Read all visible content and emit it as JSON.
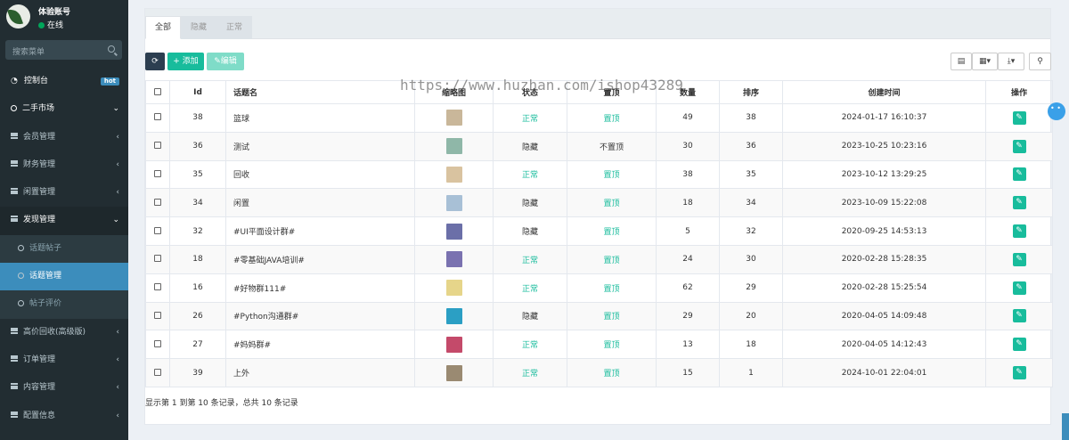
{
  "user": {
    "name": "体验账号",
    "status": "在线"
  },
  "search": {
    "placeholder": "搜索菜单"
  },
  "menu": [
    {
      "label": "控制台",
      "type": "top",
      "badge": "hot"
    },
    {
      "label": "二手市场",
      "type": "top",
      "caret": "⌄"
    },
    {
      "label": "会员管理",
      "type": "item",
      "caret": "‹"
    },
    {
      "label": "财务管理",
      "type": "item",
      "caret": "‹"
    },
    {
      "label": "闲置管理",
      "type": "item",
      "caret": "‹"
    },
    {
      "label": "发现管理",
      "type": "open",
      "caret": "⌄"
    },
    {
      "label": "话题帖子",
      "type": "sub"
    },
    {
      "label": "话题管理",
      "type": "active"
    },
    {
      "label": "帖子评价",
      "type": "sub"
    },
    {
      "label": "高价回收(高级版)",
      "type": "item",
      "caret": "‹"
    },
    {
      "label": "订单管理",
      "type": "item",
      "caret": "‹"
    },
    {
      "label": "内容管理",
      "type": "item",
      "caret": "‹"
    },
    {
      "label": "配置信息",
      "type": "item",
      "caret": "‹"
    }
  ],
  "tabs": [
    "全部",
    "隐藏",
    "正常"
  ],
  "toolbar": {
    "add": "添加",
    "edit": "编辑"
  },
  "table": {
    "headers": [
      "Id",
      "话题名",
      "缩略图",
      "状态",
      "置顶",
      "数量",
      "排序",
      "创建时间",
      "操作"
    ],
    "rows": [
      {
        "id": "38",
        "name": "篮球",
        "thumb": "#c9b79a",
        "status": "正常",
        "top": "置顶",
        "count": "49",
        "sort": "38",
        "time": "2024-01-17 16:10:37"
      },
      {
        "id": "36",
        "name": "测试",
        "thumb": "#8fb7a8",
        "status": "隐藏",
        "top": "不置顶",
        "count": "30",
        "sort": "36",
        "time": "2023-10-25 10:23:16"
      },
      {
        "id": "35",
        "name": "回收",
        "thumb": "#d9c3a0",
        "status": "正常",
        "top": "置顶",
        "count": "38",
        "sort": "35",
        "time": "2023-10-12 13:29:25"
      },
      {
        "id": "34",
        "name": "闲置",
        "thumb": "#a8c0d6",
        "status": "隐藏",
        "top": "置顶",
        "count": "18",
        "sort": "34",
        "time": "2023-10-09 15:22:08"
      },
      {
        "id": "32",
        "name": "#UI平面设计群#",
        "thumb": "#6b6fa8",
        "status": "隐藏",
        "top": "置顶",
        "count": "5",
        "sort": "32",
        "time": "2020-09-25 14:53:13"
      },
      {
        "id": "18",
        "name": "#零基础JAVA培训#",
        "thumb": "#7a72b0",
        "status": "正常",
        "top": "置顶",
        "count": "24",
        "sort": "30",
        "time": "2020-02-28 15:28:35"
      },
      {
        "id": "16",
        "name": "#好物群111#",
        "thumb": "#e6d58a",
        "status": "正常",
        "top": "置顶",
        "count": "62",
        "sort": "29",
        "time": "2020-02-28 15:25:54"
      },
      {
        "id": "26",
        "name": "#Python沟通群#",
        "thumb": "#2b9fc4",
        "status": "隐藏",
        "top": "置顶",
        "count": "29",
        "sort": "20",
        "time": "2020-04-05 14:09:48"
      },
      {
        "id": "27",
        "name": "#妈妈群#",
        "thumb": "#c44a6a",
        "status": "正常",
        "top": "置顶",
        "count": "13",
        "sort": "18",
        "time": "2020-04-05 14:12:43"
      },
      {
        "id": "39",
        "name": "上外",
        "thumb": "#9a8a72",
        "status": "正常",
        "top": "置顶",
        "count": "15",
        "sort": "1",
        "time": "2024-10-01 22:04:01"
      }
    ]
  },
  "footer": "显示第 1 到第 10 条记录，总共 10 条记录",
  "watermark": "https://www.huzhan.com/ishop43289"
}
